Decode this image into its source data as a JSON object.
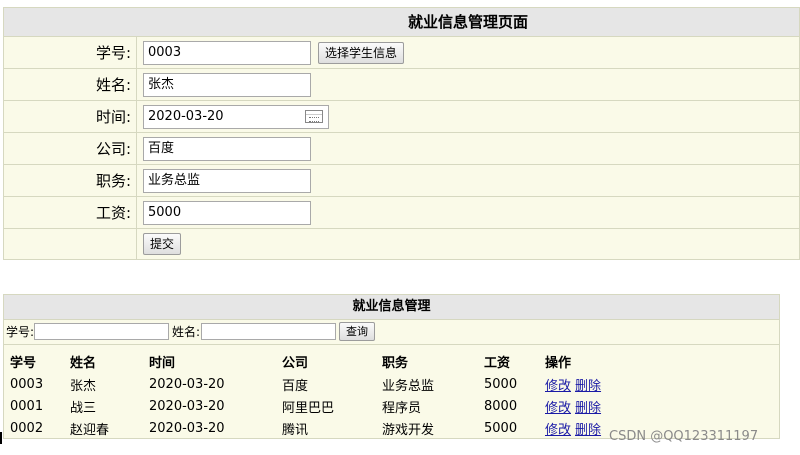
{
  "form": {
    "title": "就业信息管理页面",
    "fields": {
      "student_id": {
        "label": "学号:",
        "value": "0003"
      },
      "name": {
        "label": "姓名:",
        "value": "张杰"
      },
      "time": {
        "label": "时间:",
        "value": "2020-03-20"
      },
      "company": {
        "label": "公司:",
        "value": "百度"
      },
      "position": {
        "label": "职务:",
        "value": "业务总监"
      },
      "salary": {
        "label": "工资:",
        "value": "5000"
      }
    },
    "select_student_button": "选择学生信息",
    "submit_button": "提交"
  },
  "list": {
    "title": "就业信息管理",
    "search": {
      "student_id_label": "学号:",
      "name_label": "姓名:",
      "button": "查询"
    },
    "columns": [
      "学号",
      "姓名",
      "时间",
      "公司",
      "职务",
      "工资",
      "操作"
    ],
    "rows": [
      {
        "id": "0003",
        "name": "张杰",
        "time": "2020-03-20",
        "company": "百度",
        "position": "业务总监",
        "salary": "5000",
        "edit": "修改",
        "delete": "删除"
      },
      {
        "id": "0001",
        "name": "战三",
        "time": "2020-03-20",
        "company": "阿里巴巴",
        "position": "程序员",
        "salary": "8000",
        "edit": "修改",
        "delete": "删除"
      },
      {
        "id": "0002",
        "name": "赵迎春",
        "time": "2020-03-20",
        "company": "腾讯",
        "position": "游戏开发",
        "salary": "5000",
        "edit": "修改",
        "delete": "删除"
      }
    ]
  },
  "watermark": "CSDN @QQ123311197"
}
